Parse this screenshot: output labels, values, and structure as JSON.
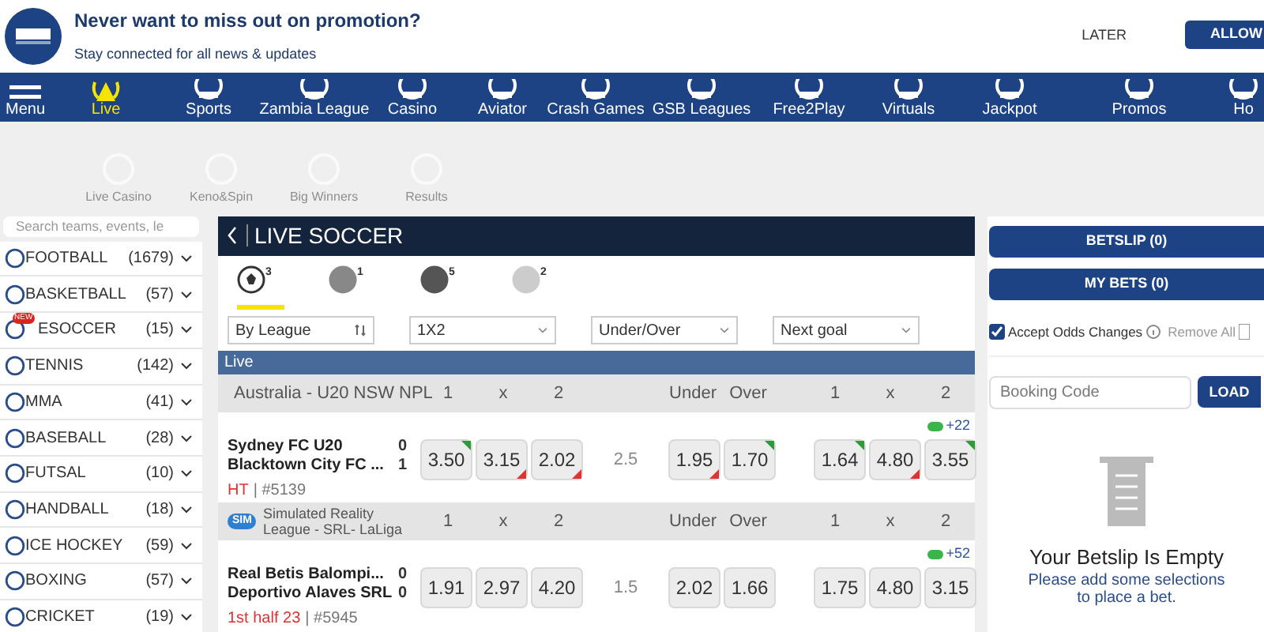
{
  "promo": {
    "title": "Never want to miss out on promotion?",
    "subtitle": "Stay connected for all news & updates",
    "later": "LATER",
    "allow": "ALLOW"
  },
  "nav": [
    {
      "label": "Menu",
      "selected": false
    },
    {
      "label": "Live",
      "selected": true
    },
    {
      "label": "Sports",
      "selected": false
    },
    {
      "label": "Zambia League",
      "selected": false
    },
    {
      "label": "Casino",
      "selected": false
    },
    {
      "label": "Aviator",
      "selected": false
    },
    {
      "label": "Crash Games",
      "selected": false
    },
    {
      "label": "GSB Leagues",
      "selected": false
    },
    {
      "label": "Free2Play",
      "selected": false
    },
    {
      "label": "Virtuals",
      "selected": false
    },
    {
      "label": "Jackpot",
      "selected": false
    },
    {
      "label": "Promos",
      "selected": false
    },
    {
      "label": "Ho",
      "selected": false
    }
  ],
  "sub_nav": [
    "Live Casino",
    "Keno&Spin",
    "Big Winners",
    "Results"
  ],
  "search": {
    "placeholder": "Search teams, events, le"
  },
  "sports": [
    {
      "name": "FOOTBALL",
      "count": "(1679)"
    },
    {
      "name": "BASKETBALL",
      "count": "(57)"
    },
    {
      "name": "ESOCCER",
      "count": "(15)",
      "badge": "NEW"
    },
    {
      "name": "TENNIS",
      "count": "(142)"
    },
    {
      "name": "MMA",
      "count": "(41)"
    },
    {
      "name": "BASEBALL",
      "count": "(28)"
    },
    {
      "name": "FUTSAL",
      "count": "(10)"
    },
    {
      "name": "HANDBALL",
      "count": "(18)"
    },
    {
      "name": "ICE HOCKEY",
      "count": "(59)"
    },
    {
      "name": "BOXING",
      "count": "(57)"
    },
    {
      "name": "CRICKET",
      "count": "(19)"
    }
  ],
  "live": {
    "title": "LIVE SOCCER",
    "sport_tabs": [
      {
        "count": "3",
        "selected": true
      },
      {
        "count": "1",
        "selected": false
      },
      {
        "count": "5",
        "selected": false
      },
      {
        "count": "2",
        "selected": false
      }
    ],
    "filters": [
      "By League",
      "1X2",
      "Under/Over",
      "Next goal"
    ],
    "section": "Live",
    "leagues": [
      {
        "kind": "flag",
        "name": "Australia - U20 NSW NPL",
        "headers": [
          "1",
          "x",
          "2",
          "Under",
          "Over",
          "1",
          "x",
          "2"
        ],
        "match": {
          "home": "Sydney FC U20",
          "away": "Blacktown City FC ...",
          "home_score": "0",
          "away_score": "1",
          "status": "HT",
          "id": "| #5139",
          "more": "+22",
          "line": "2.5",
          "odds": [
            {
              "value": "3.50",
              "rising": true,
              "falling": false
            },
            {
              "value": "3.15",
              "rising": false,
              "falling": true
            },
            {
              "value": "2.02",
              "rising": false,
              "falling": true
            }
          ],
          "ou": [
            {
              "value": "1.95",
              "rising": false,
              "falling": true
            },
            {
              "value": "1.70",
              "rising": true,
              "falling": false
            }
          ],
          "next_goal": [
            {
              "value": "1.64",
              "rising": true,
              "falling": false
            },
            {
              "value": "4.80",
              "rising": false,
              "falling": true
            },
            {
              "value": "3.55",
              "rising": true,
              "falling": false
            }
          ]
        }
      },
      {
        "kind": "sim",
        "badge": "SIM",
        "name": "Simulated Reality League - SRL- LaLiga",
        "headers": [
          "1",
          "x",
          "2",
          "Under",
          "Over",
          "1",
          "x",
          "2"
        ],
        "match": {
          "home": "Real Betis Balompi...",
          "away": "Deportivo Alaves SRL",
          "home_score": "0",
          "away_score": "0",
          "status": "1st half 23",
          "id": "| #5945",
          "more": "+52",
          "line": "1.5",
          "odds": [
            {
              "value": "1.91",
              "rising": false,
              "falling": false
            },
            {
              "value": "2.97",
              "rising": false,
              "falling": false
            },
            {
              "value": "4.20",
              "rising": false,
              "falling": false
            }
          ],
          "ou": [
            {
              "value": "2.02",
              "rising": false,
              "falling": false
            },
            {
              "value": "1.66",
              "rising": false,
              "falling": false
            }
          ],
          "next_goal": [
            {
              "value": "1.75",
              "rising": false,
              "falling": false
            },
            {
              "value": "4.80",
              "rising": false,
              "falling": false
            },
            {
              "value": "3.15",
              "rising": false,
              "falling": false
            }
          ]
        }
      }
    ]
  },
  "betslip": {
    "tabs": [
      "BETSLIP (0)",
      "MY BETS (0)"
    ],
    "accept_label": "Accept Odds Changes",
    "accept_checked": true,
    "remove_all": "Remove All",
    "booking_placeholder": "Booking Code",
    "load": "LOAD",
    "empty_title": "Your Betslip Is Empty",
    "empty_text": "Please add some selections to place a bet."
  }
}
